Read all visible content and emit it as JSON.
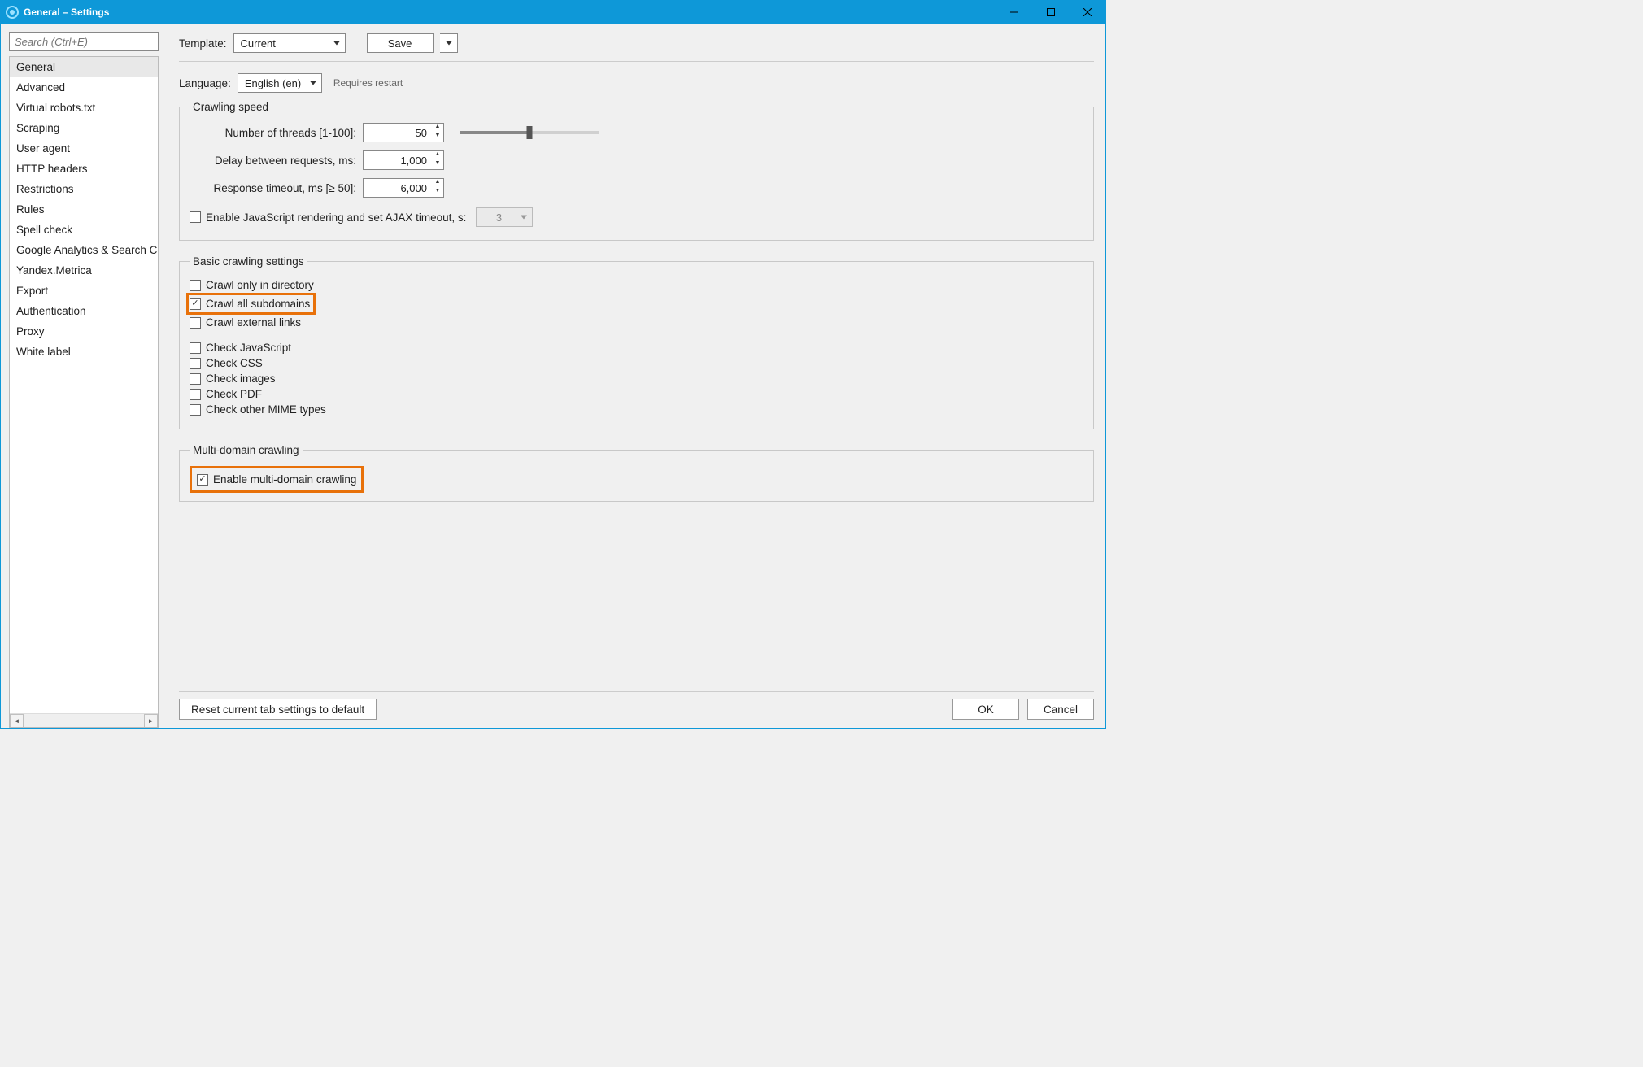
{
  "window": {
    "title": "General – Settings"
  },
  "sidebar": {
    "search_placeholder": "Search (Ctrl+E)",
    "items": [
      "General",
      "Advanced",
      "Virtual robots.txt",
      "Scraping",
      "User agent",
      "HTTP headers",
      "Restrictions",
      "Rules",
      "Spell check",
      "Google Analytics & Search Console",
      "Yandex.Metrica",
      "Export",
      "Authentication",
      "Proxy",
      "White label"
    ],
    "selected_index": 0
  },
  "toolbar": {
    "template_label": "Template:",
    "template_value": "Current",
    "save_label": "Save"
  },
  "language": {
    "label": "Language:",
    "value": "English (en)",
    "hint": "Requires restart"
  },
  "crawling_speed": {
    "legend": "Crawling speed",
    "threads_label": "Number of threads [1-100]:",
    "threads_value": "50",
    "delay_label": "Delay between requests, ms:",
    "delay_value": "1,000",
    "timeout_label": "Response timeout, ms [≥ 50]:",
    "timeout_value": "6,000",
    "js_label": "Enable JavaScript rendering and set AJAX timeout, s:",
    "js_value": "3"
  },
  "basic": {
    "legend": "Basic crawling settings",
    "crawl_dir": "Crawl only in directory",
    "crawl_sub": "Crawl all subdomains",
    "crawl_ext": "Crawl external links",
    "check_js": "Check JavaScript",
    "check_css": "Check CSS",
    "check_img": "Check images",
    "check_pdf": "Check PDF",
    "check_mime": "Check other MIME types"
  },
  "multi": {
    "legend": "Multi-domain crawling",
    "enable": "Enable multi-domain crawling"
  },
  "footer": {
    "reset": "Reset current tab settings to default",
    "ok": "OK",
    "cancel": "Cancel"
  }
}
